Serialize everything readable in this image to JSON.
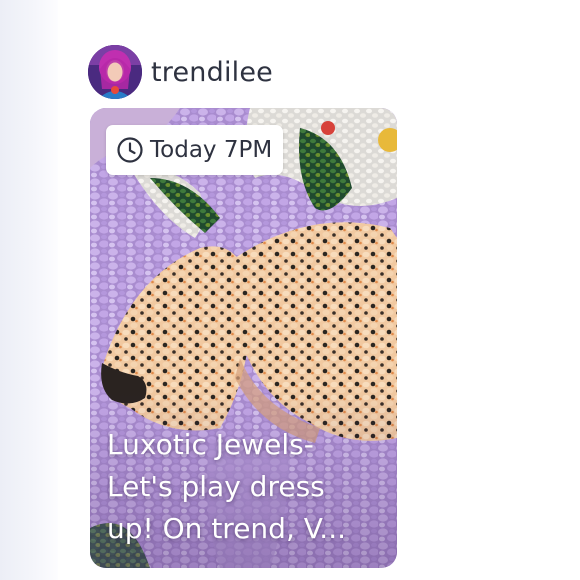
{
  "post": {
    "username": "trendilee",
    "listing": {
      "time_label": "Today 7PM",
      "title_line_1": "Luxotic Jewels-",
      "title_line_2": "Let's play dress",
      "title_line_3": "up! On trend, V..."
    }
  },
  "icons": {
    "clock": "clock-icon",
    "avatar": "profile-avatar"
  },
  "colors": {
    "username_text": "#2e3240",
    "card_background": "#b7a0d9",
    "badge_background": "#ffffff",
    "title_text": "#ffffff"
  }
}
